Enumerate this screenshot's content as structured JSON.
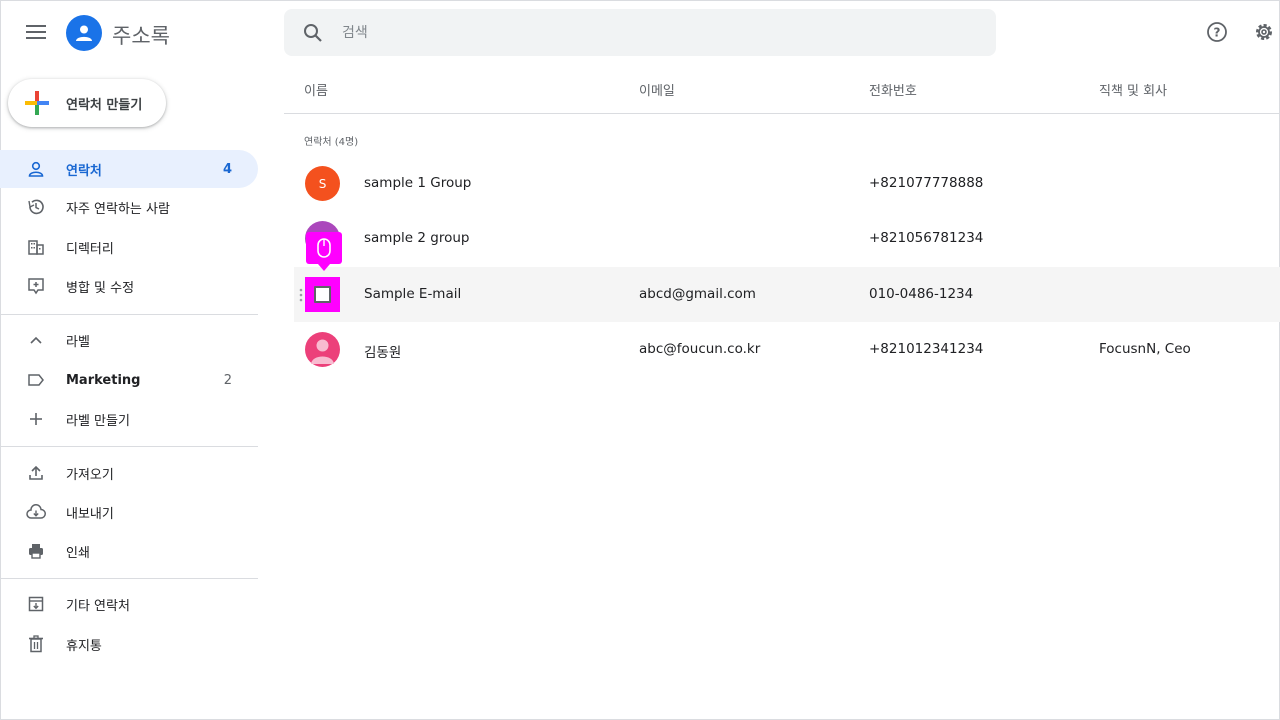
{
  "header": {
    "app_title": "주소록",
    "search_placeholder": "검색"
  },
  "sidebar": {
    "create_label": "연락처 만들기",
    "items": [
      {
        "label": "연락처",
        "count": "4"
      },
      {
        "label": "자주 연락하는 사람"
      },
      {
        "label": "디렉터리"
      },
      {
        "label": "병합 및 수정"
      }
    ],
    "labels_header": "라벨",
    "label_items": [
      {
        "label": "Marketing",
        "count": "2"
      }
    ],
    "create_label_item": "라벨 만들기",
    "tools": [
      {
        "label": "가져오기"
      },
      {
        "label": "내보내기"
      },
      {
        "label": "인쇄"
      }
    ],
    "other": [
      {
        "label": "기타 연락처"
      },
      {
        "label": "휴지통"
      }
    ]
  },
  "table": {
    "columns": [
      "이름",
      "이메일",
      "전화번호",
      "직책 및 회사"
    ],
    "section_label": "연락처 (4명)",
    "rows": [
      {
        "initial": "S",
        "name": "sample 1 Group",
        "email": "",
        "phone": "+821077778888",
        "job": "",
        "avatar_color": "#f4511e"
      },
      {
        "initial": "",
        "name": "sample 2 group",
        "email": "",
        "phone": "+821056781234",
        "job": "",
        "avatar_color": "#ab47bc"
      },
      {
        "initial": "",
        "name": "Sample E-mail",
        "email": "abcd@gmail.com",
        "phone": "010-0486-1234",
        "job": "",
        "avatar_color": "#ff00ff"
      },
      {
        "initial": "",
        "name": "김동원",
        "email": "abc@foucun.co.kr",
        "phone": "+821012341234",
        "job": "FocusnN, Ceo",
        "avatar_color": "#ec407a"
      }
    ]
  },
  "colors": {
    "accent": "#1a73e8",
    "active_bg": "#e8f0fe",
    "highlight": "#ff00ff"
  }
}
